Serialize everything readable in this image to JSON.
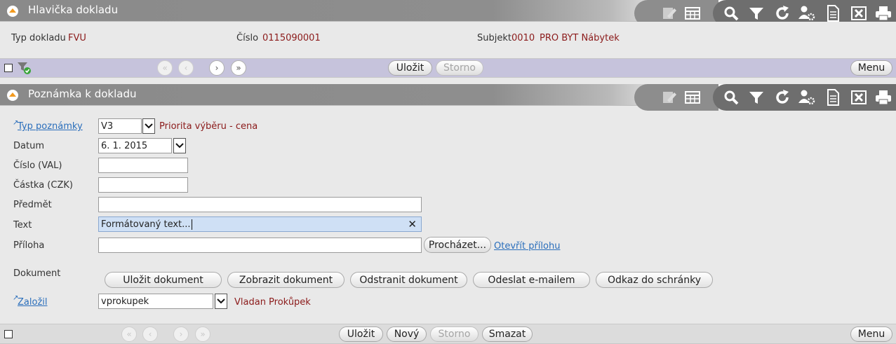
{
  "header_panel": {
    "title": "Hlavička dokladu",
    "fields": {
      "typ_label": "Typ dokladu",
      "typ_value": "FVU",
      "cislo_label": "Číslo",
      "cislo_value": "0115090001",
      "subjekt_label": "Subjekt",
      "subjekt_code": "0010",
      "subjekt_name": "PRO BYT Nábytek"
    },
    "nav": {
      "save": "Uložit",
      "cancel": "Storno",
      "menu": "Menu"
    }
  },
  "note_panel": {
    "title": "Poznámka k dokladu",
    "typ_poznamky": {
      "label": "Typ poznámky",
      "value": "V3",
      "desc": "Priorita výběru - cena"
    },
    "datum": {
      "label": "Datum",
      "value": "6. 1. 2015"
    },
    "cislo_val": {
      "label": "Číslo (VAL)",
      "value": ""
    },
    "castka": {
      "label": "Částka (CZK)",
      "value": ""
    },
    "predmet": {
      "label": "Předmět",
      "value": ""
    },
    "text": {
      "label": "Text",
      "value": "Formátovaný text..."
    },
    "priloha": {
      "label": "Příloha",
      "value": "",
      "browse": "Procházet...",
      "open_link": "Otevřít přílohu"
    },
    "dokument": {
      "label": "Dokument",
      "buttons": [
        "Uložit dokument",
        "Zobrazit dokument",
        "Odstranit dokument",
        "Odeslat e-mailem",
        "Odkaz do schránky"
      ]
    },
    "zalozil": {
      "label": "Založil",
      "value": "vprokupek",
      "desc": "Vladan Prokůpek"
    }
  },
  "bottom_nav": {
    "save": "Uložit",
    "new": "Nový",
    "cancel": "Storno",
    "delete": "Smazat",
    "menu": "Menu"
  },
  "toolbar_icons": [
    "edit-icon",
    "grid-icon",
    "search-icon",
    "filter-icon",
    "refresh-icon",
    "user-settings-icon",
    "document-icon",
    "excel-icon",
    "print-icon"
  ],
  "colors": {
    "value_text": "#8b1a1a",
    "link": "#2a6ebb",
    "accent": "#f39a1e",
    "nav_purple": "#c6c3dc"
  }
}
